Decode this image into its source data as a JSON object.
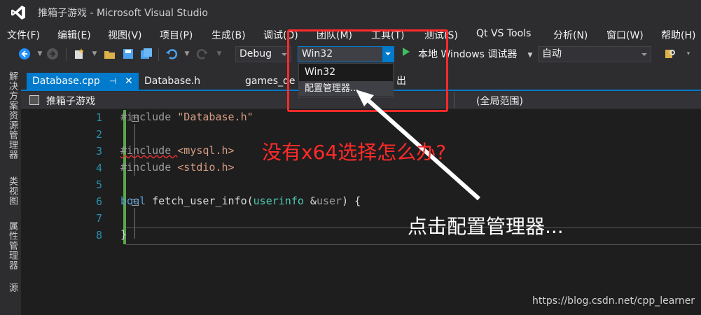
{
  "window": {
    "title": "推箱子游戏 - Microsoft Visual Studio"
  },
  "menu": [
    "文件(F)",
    "编辑(E)",
    "视图(V)",
    "项目(P)",
    "生成(B)",
    "调试(D)",
    "团队(M)",
    "工具(T)",
    "测试(S)",
    "Qt VS Tools",
    "分析(N)",
    "窗口(W)",
    "帮助(H)"
  ],
  "toolbar": {
    "config": "Debug",
    "platform": "Win32",
    "run_label": "本地 Windows 调试器",
    "solution_config": "自动"
  },
  "dropdown": {
    "items": [
      "Win32",
      "配置管理器..."
    ]
  },
  "side_tabs": [
    "解决方案资源管理器",
    "类视图",
    "属性管理器",
    "团队资源"
  ],
  "tabs": [
    {
      "label": "Database.cpp",
      "active": true
    },
    {
      "label": "Database.h",
      "active": false
    },
    {
      "label": "games_de",
      "active": false
    },
    {
      "label": "出",
      "active": false
    }
  ],
  "navbar": {
    "project": "推箱子游戏",
    "scope": "(全局范围)"
  },
  "code": {
    "line_numbers": [
      "1",
      "2",
      "3",
      "4",
      "5",
      "6",
      "7",
      "8"
    ],
    "lines": [
      {
        "pp": "#include ",
        "str": "\"Database.h\""
      },
      {},
      {
        "pp": "#include ",
        "str": "<mysql.h>"
      },
      {
        "pp": "#include ",
        "str": "<stdio.h>"
      },
      {},
      {
        "kw": "bool",
        "rest": " fetch_user_info(",
        "type": "userinfo",
        "rest2": " &",
        "param": "user",
        "rest3": ") {"
      },
      {},
      {
        "rest": "}"
      }
    ]
  },
  "annotations": {
    "question": "没有x64选择怎么办?",
    "answer": "点击配置管理器...",
    "watermark": "https://blog.csdn.net/cpp_learner"
  },
  "colors": {
    "accent": "#007acc",
    "annotation_red": "#ff2a2a",
    "editor_bg": "#1e1e1e"
  }
}
